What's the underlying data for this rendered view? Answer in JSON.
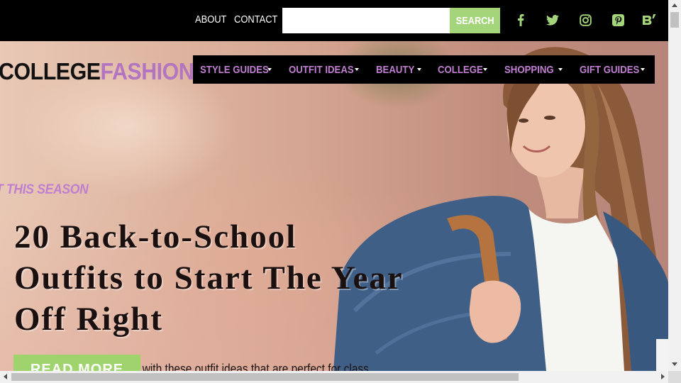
{
  "topbar": {
    "about": "ABOUT",
    "contact": "CONTACT",
    "search_placeholder": "",
    "search_button": "SEARCH",
    "social_icons": [
      "facebook-icon",
      "twitter-icon",
      "instagram-icon",
      "pinterest-icon",
      "bloglovin-icon"
    ]
  },
  "logo": {
    "part1": "COLLEGE",
    "part2": "FASHION"
  },
  "mainnav": {
    "items": [
      {
        "label": "STYLE GUIDES"
      },
      {
        "label": "OUTFIT IDEAS"
      },
      {
        "label": "BEAUTY"
      },
      {
        "label": "COLLEGE"
      },
      {
        "label": "SHOPPING"
      },
      {
        "label": "GIFT GUIDES"
      }
    ]
  },
  "hero": {
    "eyebrow": "T THIS SEASON",
    "headline": "20 Back-to-School Outfits to Start The Year Off Right",
    "subtitle": "Go back to school in style with these outfit ideas that are perfect for class.",
    "button": "READ MORE"
  },
  "colors": {
    "accent_purple": "#c07fd0",
    "logo_purple": "#b374c0",
    "accent_green": "#a5d57b",
    "topbar": "#000000"
  }
}
